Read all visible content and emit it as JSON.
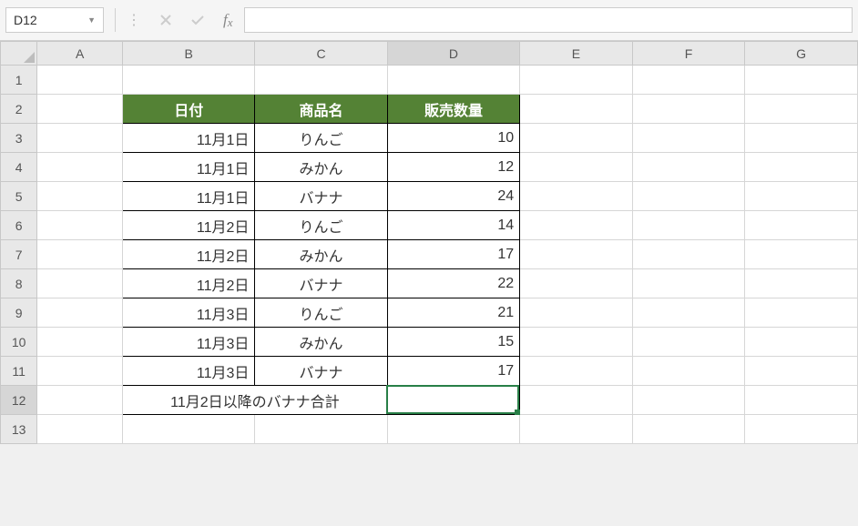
{
  "nameBox": "D12",
  "formulaBar": "",
  "columnLetters": [
    "A",
    "B",
    "C",
    "D",
    "E",
    "F",
    "G"
  ],
  "rowNumbers": [
    "1",
    "2",
    "3",
    "4",
    "5",
    "6",
    "7",
    "8",
    "9",
    "10",
    "11",
    "12",
    "13"
  ],
  "activeColIndex": 3,
  "activeRowIndex": 11,
  "tableHeaders": {
    "date": "日付",
    "product": "商品名",
    "qty": "販売数量"
  },
  "rows": [
    {
      "date": "11月1日",
      "product": "りんご",
      "qty": "10"
    },
    {
      "date": "11月1日",
      "product": "みかん",
      "qty": "12"
    },
    {
      "date": "11月1日",
      "product": "バナナ",
      "qty": "24"
    },
    {
      "date": "11月2日",
      "product": "りんご",
      "qty": "14"
    },
    {
      "date": "11月2日",
      "product": "みかん",
      "qty": "17"
    },
    {
      "date": "11月2日",
      "product": "バナナ",
      "qty": "22"
    },
    {
      "date": "11月3日",
      "product": "りんご",
      "qty": "21"
    },
    {
      "date": "11月3日",
      "product": "みかん",
      "qty": "15"
    },
    {
      "date": "11月3日",
      "product": "バナナ",
      "qty": "17"
    }
  ],
  "totalLabel": "11月2日以降のバナナ合計",
  "totalValue": ""
}
